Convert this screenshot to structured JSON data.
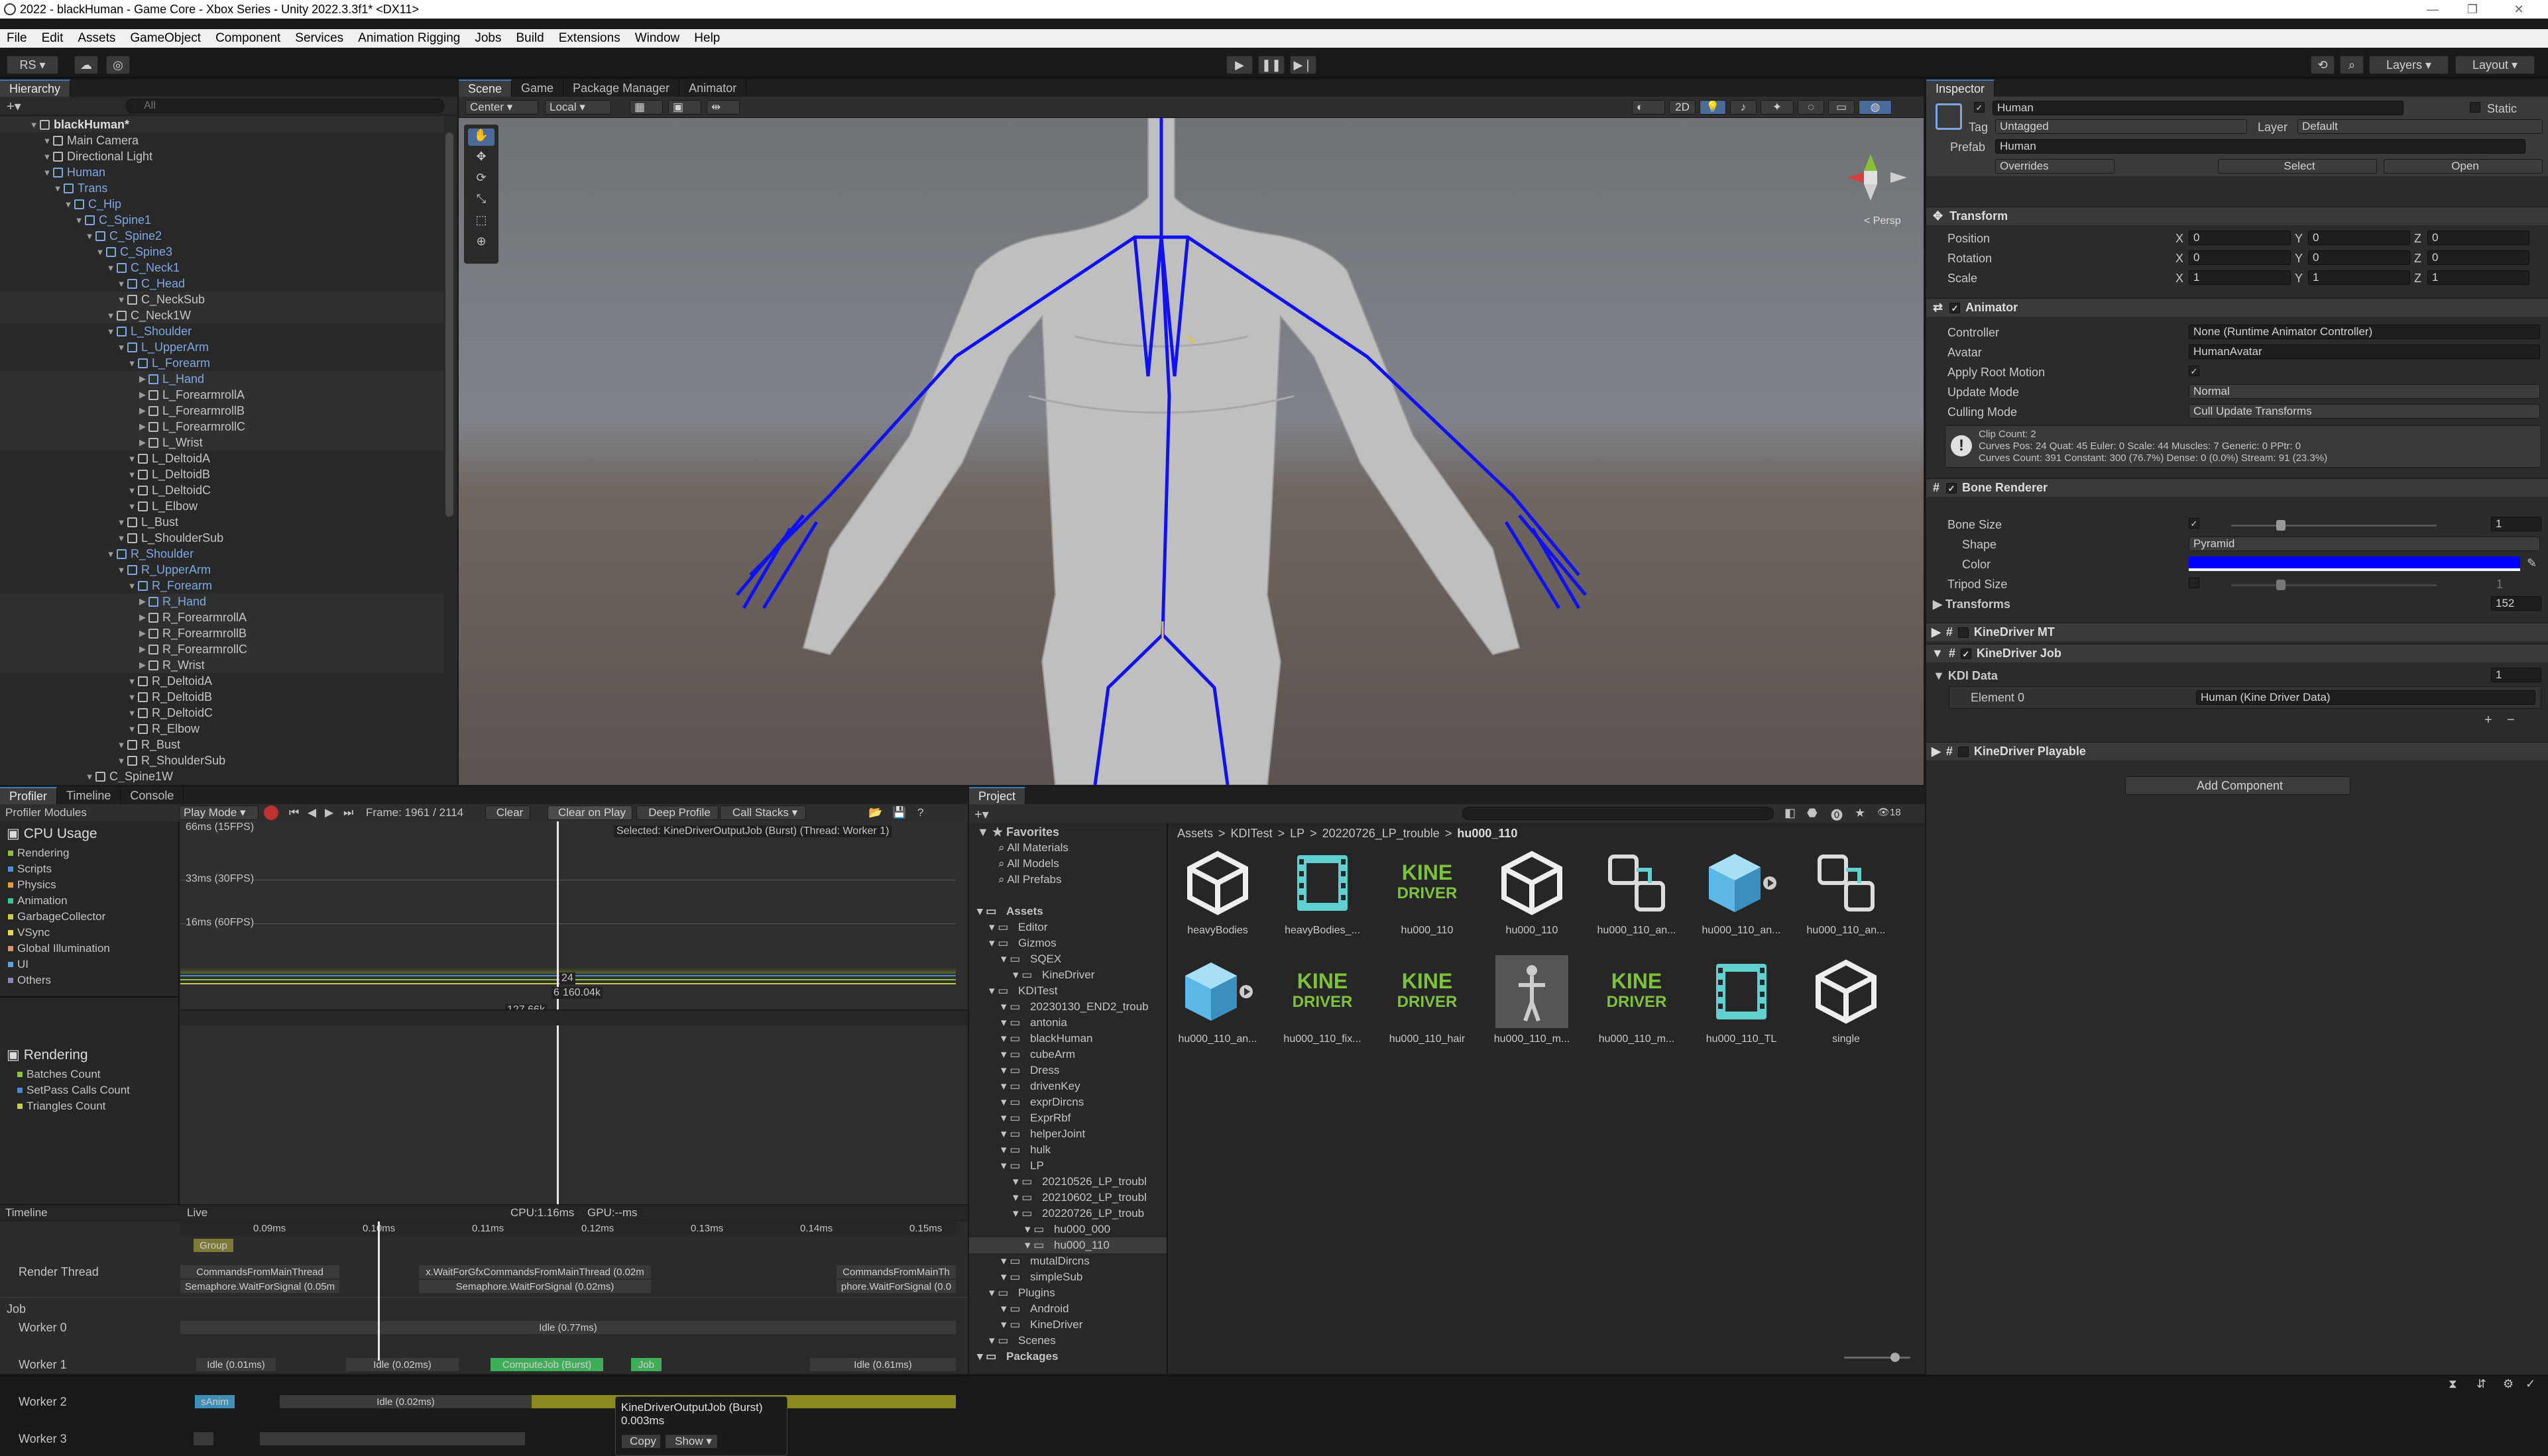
{
  "window": {
    "title": "2022 - blackHuman - Game Core - Xbox Series - Unity 2022.3.3f1* <DX11>"
  },
  "menu": [
    "File",
    "Edit",
    "Assets",
    "GameObject",
    "Component",
    "Services",
    "Animation Rigging",
    "Jobs",
    "Build",
    "Extensions",
    "Window",
    "Help"
  ],
  "toolbar": {
    "account": "RS ▾",
    "layers": "Layers",
    "layout": "Layout"
  },
  "hierarchy": {
    "tab": "Hierarchy",
    "search_placeholder": "All",
    "scene": "blackHuman*",
    "items": [
      {
        "label": "Main Camera",
        "depth": 1,
        "blue": false
      },
      {
        "label": "Directional Light",
        "depth": 1,
        "blue": false
      },
      {
        "label": "Human",
        "depth": 1,
        "blue": true
      },
      {
        "label": "Trans",
        "depth": 2,
        "blue": true
      },
      {
        "label": "C_Hip",
        "depth": 3,
        "blue": true
      },
      {
        "label": "C_Spine1",
        "depth": 4,
        "blue": true
      },
      {
        "label": "C_Spine2",
        "depth": 5,
        "blue": true
      },
      {
        "label": "C_Spine3",
        "depth": 6,
        "blue": true
      },
      {
        "label": "C_Neck1",
        "depth": 7,
        "blue": true
      },
      {
        "label": "C_Head",
        "depth": 8,
        "blue": true
      },
      {
        "label": "C_NeckSub",
        "depth": 8,
        "blue": false
      },
      {
        "label": "C_Neck1W",
        "depth": 7,
        "blue": false
      },
      {
        "label": "L_Shoulder",
        "depth": 7,
        "blue": true
      },
      {
        "label": "L_UpperArm",
        "depth": 8,
        "blue": true
      },
      {
        "label": "L_Forearm",
        "depth": 9,
        "blue": true
      },
      {
        "label": "L_Hand",
        "depth": 10,
        "blue": true
      },
      {
        "label": "L_ForearmrollA",
        "depth": 10,
        "blue": false
      },
      {
        "label": "L_ForearmrollB",
        "depth": 10,
        "blue": false
      },
      {
        "label": "L_ForearmrollC",
        "depth": 10,
        "blue": false
      },
      {
        "label": "L_Wrist",
        "depth": 10,
        "blue": false
      },
      {
        "label": "L_DeltoidA",
        "depth": 9,
        "blue": false
      },
      {
        "label": "L_DeltoidB",
        "depth": 9,
        "blue": false
      },
      {
        "label": "L_DeltoidC",
        "depth": 9,
        "blue": false
      },
      {
        "label": "L_Elbow",
        "depth": 9,
        "blue": false
      },
      {
        "label": "L_Bust",
        "depth": 8,
        "blue": false
      },
      {
        "label": "L_ShoulderSub",
        "depth": 8,
        "blue": false
      },
      {
        "label": "R_Shoulder",
        "depth": 7,
        "blue": true
      },
      {
        "label": "R_UpperArm",
        "depth": 8,
        "blue": true
      },
      {
        "label": "R_Forearm",
        "depth": 9,
        "blue": true
      },
      {
        "label": "R_Hand",
        "depth": 10,
        "blue": true
      },
      {
        "label": "R_ForearmrollA",
        "depth": 10,
        "blue": false
      },
      {
        "label": "R_ForearmrollB",
        "depth": 10,
        "blue": false
      },
      {
        "label": "R_ForearmrollC",
        "depth": 10,
        "blue": false
      },
      {
        "label": "R_Wrist",
        "depth": 10,
        "blue": false
      },
      {
        "label": "R_DeltoidA",
        "depth": 9,
        "blue": false
      },
      {
        "label": "R_DeltoidB",
        "depth": 9,
        "blue": false
      },
      {
        "label": "R_DeltoidC",
        "depth": 9,
        "blue": false
      },
      {
        "label": "R_Elbow",
        "depth": 9,
        "blue": false
      },
      {
        "label": "R_Bust",
        "depth": 8,
        "blue": false
      },
      {
        "label": "R_ShoulderSub",
        "depth": 8,
        "blue": false
      },
      {
        "label": "C_Spine1W",
        "depth": 5,
        "blue": false
      }
    ]
  },
  "scene": {
    "tabs": [
      "Scene",
      "Game",
      "Package Manager",
      "Animator"
    ],
    "pivot": "Center",
    "space": "Local",
    "mode2d": "2D",
    "persp": "< Persp"
  },
  "inspector": {
    "tab": "Inspector",
    "name": "Human",
    "static": "Static",
    "tag_label": "Tag",
    "tag": "Untagged",
    "layer_label": "Layer",
    "layer": "Default",
    "prefab_label": "Prefab",
    "prefab": "Human",
    "overrides": "Overrides",
    "select": "Select",
    "open": "Open",
    "transform": {
      "title": "Transform",
      "position": "Position",
      "rotation": "Rotation",
      "scale": "Scale",
      "pos": [
        "0",
        "0",
        "0"
      ],
      "rot": [
        "0",
        "0",
        "0"
      ],
      "scl": [
        "1",
        "1",
        "1"
      ]
    },
    "animator": {
      "title": "Animator",
      "controller_label": "Controller",
      "controller": "None (Runtime Animator Controller)",
      "avatar_label": "Avatar",
      "avatar": "HumanAvatar",
      "root_motion": "Apply Root Motion",
      "update_label": "Update Mode",
      "update": "Normal",
      "culling_label": "Culling Mode",
      "culling": "Cull Update Transforms",
      "info1": "Clip Count: 2",
      "info2": "Curves Pos: 24 Quat: 45 Euler: 0 Scale: 44 Muscles: 7 Generic: 0 PPtr: 0",
      "info3": "Curves Count: 391 Constant: 300 (76.7%) Dense: 0 (0.0%) Stream: 91 (23.3%)"
    },
    "bone": {
      "title": "Bone Renderer",
      "size_label": "Bone Size",
      "size": "1",
      "shape_label": "Shape",
      "shape": "Pyramid",
      "color_label": "Color",
      "color": "#0000ff",
      "tripod_label": "Tripod Size",
      "tripod": "1",
      "transforms_label": "Transforms",
      "transforms": "152"
    },
    "kine_mt": "KineDriver MT",
    "kine_job": "KineDriver Job",
    "kdi_label": "KDI Data",
    "kdi_count": "1",
    "element_label": "Element 0",
    "element": "Human (Kine Driver Data)",
    "kine_playable": "KineDriver Playable",
    "add_component": "Add Component"
  },
  "profiler": {
    "tabs": [
      "Profiler",
      "Timeline",
      "Console"
    ],
    "modules": "Profiler Modules",
    "playmode": "Play Mode ▾",
    "frame": "Frame: 1961 / 2114",
    "clear": "Clear",
    "clear_on_play": "Clear on Play",
    "deep": "Deep Profile",
    "callstacks": "Call Stacks ▾",
    "cpu_title": "CPU Usage",
    "cpu_items": [
      {
        "label": "Rendering",
        "color": "#8fbf3f"
      },
      {
        "label": "Scripts",
        "color": "#4a8bd8"
      },
      {
        "label": "Physics",
        "color": "#e29a3b"
      },
      {
        "label": "Animation",
        "color": "#3fbfa3"
      },
      {
        "label": "GarbageCollector",
        "color": "#c9c94a"
      },
      {
        "label": "VSync",
        "color": "#e6d44d"
      },
      {
        "label": "Global Illumination",
        "color": "#d4956a"
      },
      {
        "label": "UI",
        "color": "#5fa0d8"
      },
      {
        "label": "Others",
        "color": "#8c7fb8"
      }
    ],
    "render_title": "Rendering",
    "render_items": [
      "Batches Count",
      "SetPass Calls Count",
      "Triangles Count"
    ],
    "fps15": "66ms (15FPS)",
    "fps30": "33ms (30FPS)",
    "fps60": "16ms (60FPS)",
    "selected": "Selected: KineDriverOutputJob (Burst) (Thread: Worker 1)",
    "val1": "24",
    "val2": "160.04k",
    "val3": "127.66k",
    "val4": "6",
    "timeline": "Timeline",
    "live": "Live",
    "cpu": "CPU:1.16ms",
    "gpu": "GPU:--ms",
    "ticks": [
      "0.09ms",
      "0.10ms",
      "0.11ms",
      "0.12ms",
      "0.13ms",
      "0.14ms",
      "0.15ms"
    ],
    "threads": [
      "Render Thread",
      "Job",
      "Worker 0",
      "Worker 1",
      "Worker 2",
      "Worker 3"
    ],
    "bars": {
      "rt1": "CommandsFromMainThread",
      "rt2": "x.WaitForGfxCommandsFromMainThread (0.02m",
      "rt3": "CommandsFromMainTh",
      "rt4": "Semaphore.WaitForSignal (0.05m",
      "rt5": "Semaphore.WaitForSignal (0.02ms)",
      "rt6": "phore.WaitForSignal (0.0",
      "w0": "Idle (0.77ms)",
      "w1a": "Idle (0.01ms)",
      "w1b": "Idle (0.02ms)",
      "w1c": "ComputeJob (Burst)",
      "w1d": "Job",
      "w1e": "Idle (0.61ms)",
      "w2a": "sAnim",
      "w2b": "Idle (0.02ms)",
      "w2c": "0.32ms)",
      "group": "Group"
    },
    "tooltip": {
      "title": "KineDriverOutputJob (Burst)",
      "time": "0.003ms",
      "copy": "Copy",
      "show": "Show ▾"
    }
  },
  "project": {
    "tab": "Project",
    "favorites": "Favorites",
    "fav_items": [
      "All Materials",
      "All Models",
      "All Prefabs"
    ],
    "tree": [
      {
        "label": "Assets",
        "depth": 0
      },
      {
        "label": "Editor",
        "depth": 1
      },
      {
        "label": "Gizmos",
        "depth": 1
      },
      {
        "label": "SQEX",
        "depth": 2
      },
      {
        "label": "KineDriver",
        "depth": 3
      },
      {
        "label": "KDITest",
        "depth": 1
      },
      {
        "label": "20230130_END2_troub",
        "depth": 2
      },
      {
        "label": "antonia",
        "depth": 2
      },
      {
        "label": "blackHuman",
        "depth": 2
      },
      {
        "label": "cubeArm",
        "depth": 2
      },
      {
        "label": "Dress",
        "depth": 2
      },
      {
        "label": "drivenKey",
        "depth": 2
      },
      {
        "label": "exprDircns",
        "depth": 2
      },
      {
        "label": "ExprRbf",
        "depth": 2
      },
      {
        "label": "helperJoint",
        "depth": 2
      },
      {
        "label": "hulk",
        "depth": 2
      },
      {
        "label": "LP",
        "depth": 2
      },
      {
        "label": "20210526_LP_troubl",
        "depth": 3
      },
      {
        "label": "20210602_LP_troubl",
        "depth": 3
      },
      {
        "label": "20220726_LP_troub",
        "depth": 3
      },
      {
        "label": "hu000_000",
        "depth": 4
      },
      {
        "label": "hu000_110",
        "depth": 4
      },
      {
        "label": "mutalDircns",
        "depth": 2
      },
      {
        "label": "simpleSub",
        "depth": 2
      },
      {
        "label": "Plugins",
        "depth": 1
      },
      {
        "label": "Android",
        "depth": 2
      },
      {
        "label": "KineDriver",
        "depth": 2
      },
      {
        "label": "Scenes",
        "depth": 1
      },
      {
        "label": "Packages",
        "depth": 0
      }
    ],
    "breadcrumb": [
      "Assets",
      "KDITest",
      "LP",
      "20220726_LP_trouble",
      "hu000_110"
    ],
    "assets": [
      {
        "label": "heavyBodies",
        "kind": "unity"
      },
      {
        "label": "heavyBodies_...",
        "kind": "film"
      },
      {
        "label": "hu000_110",
        "kind": "kine"
      },
      {
        "label": "hu000_110",
        "kind": "unity"
      },
      {
        "label": "hu000_110_an...",
        "kind": "link"
      },
      {
        "label": "hu000_110_an...",
        "kind": "cube"
      },
      {
        "label": "hu000_110_an...",
        "kind": "link2"
      },
      {
        "label": "hu000_110_an...",
        "kind": "cube"
      },
      {
        "label": "hu000_110_fix...",
        "kind": "kine"
      },
      {
        "label": "hu000_110_hair",
        "kind": "kine"
      },
      {
        "label": "hu000_110_m...",
        "kind": "model"
      },
      {
        "label": "hu000_110_m...",
        "kind": "kine"
      },
      {
        "label": "hu000_110_TL",
        "kind": "film"
      },
      {
        "label": "single",
        "kind": "unity"
      }
    ],
    "kine_text": "KINE",
    "driver_text": "DRIVER",
    "count": "18"
  }
}
